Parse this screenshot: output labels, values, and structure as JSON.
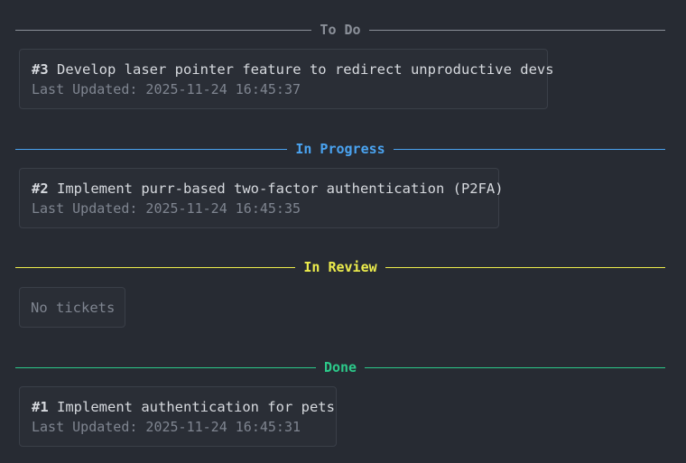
{
  "colors": {
    "todo": "#8b9099",
    "in_progress": "#4aa3f0",
    "in_review": "#ecec4c",
    "done": "#2cc98a"
  },
  "columns": [
    {
      "label": "To Do",
      "tickets": [
        {
          "number": "#3",
          "title": "Develop laser pointer feature to redirect unproductive devs",
          "updated": "Last Updated: 2025-11-24 16:45:37"
        }
      ]
    },
    {
      "label": "In Progress",
      "tickets": [
        {
          "number": "#2",
          "title": "Implement purr-based two-factor authentication (P2FA)",
          "updated": "Last Updated: 2025-11-24 16:45:35"
        }
      ]
    },
    {
      "label": "In Review",
      "empty_text": "No tickets",
      "tickets": []
    },
    {
      "label": "Done",
      "tickets": [
        {
          "number": "#1",
          "title": "Implement authentication for pets",
          "updated": "Last Updated: 2025-11-24 16:45:31"
        }
      ]
    }
  ]
}
